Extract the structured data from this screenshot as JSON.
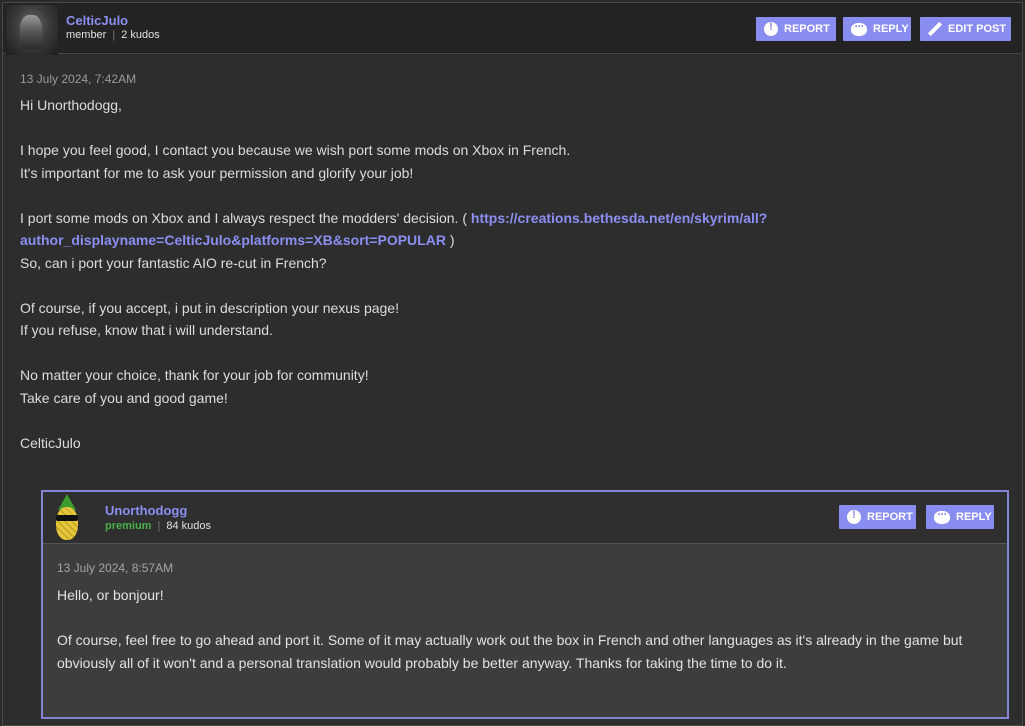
{
  "post": {
    "author": "CelticJulo",
    "role": "member",
    "kudos": "2 kudos",
    "buttons": {
      "report": "REPORT",
      "reply": "REPLY",
      "edit": "EDIT POST"
    },
    "date": "13 July 2024, 7:42AM",
    "greeting": "Hi Unorthodogg,",
    "line1": "I hope you feel good, I contact you because we wish port some mods on Xbox in French.",
    "line2": "It's important for me to ask your permission and glorify your job!",
    "line3_pre": "I port some mods on Xbox and I always respect the modders' decision. ( ",
    "link": "https://creations.bethesda.net/en/skyrim/all?author_displayname=CelticJulo&platforms=XB&sort=POPULAR",
    "link_line1": "https://creations.bethesda.net/en/skyrim/all?",
    "link_line2": "author_displayname=CelticJulo&platforms=XB&sort=POPULAR",
    "line3_post": " )",
    "line4": "So, can i port your fantastic AIO re-cut in French?",
    "line5": "Of course, if you accept, i put in description your nexus page!",
    "line6": "If you refuse, know that i will understand.",
    "line7": "No matter your choice, thank for your job for community!",
    "line8": "Take care of you and good game!",
    "signature": "CelticJulo"
  },
  "reply": {
    "author": "Unorthodogg",
    "role": "premium",
    "kudos": "84 kudos",
    "buttons": {
      "report": "REPORT",
      "reply": "REPLY"
    },
    "date": "13 July 2024, 8:57AM",
    "para1": "Hello, or bonjour!",
    "para2": "Of course, feel free to go ahead and port it. Some of it may actually work out the box in French and other languages as it's already in the game but obviously all of it won't and a personal translation would probably be better anyway. Thanks for taking the time to do it."
  },
  "colors": {
    "accent": "#8a8df0",
    "premium": "#4ab04a",
    "reply_border": "#8285d6"
  },
  "icons": {
    "report": "alert-circle-icon",
    "reply": "speech-bubble-icon",
    "edit": "pencil-icon"
  }
}
